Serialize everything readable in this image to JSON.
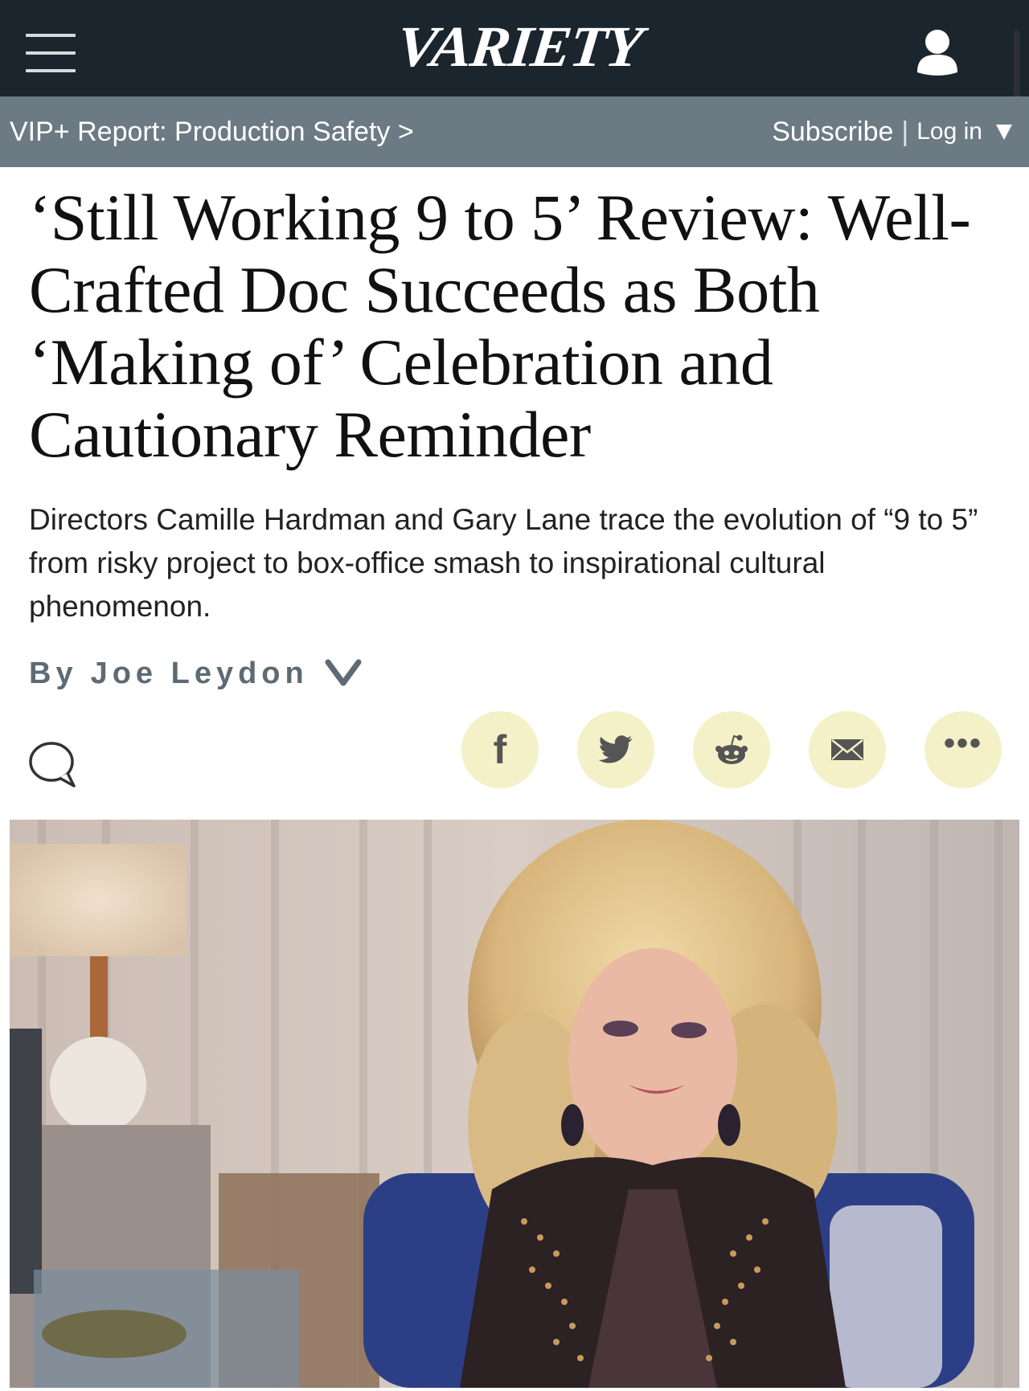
{
  "nav": {
    "logo": "VARIETY",
    "menu_icon": "hamburger-menu-icon",
    "user_icon": "user-icon"
  },
  "subbar": {
    "vip_link": "VIP+ Report: Production Safety >",
    "subscribe": "Subscribe",
    "separator": "|",
    "login": "Log in"
  },
  "article": {
    "headline": "‘Still Working 9 to 5’ Review: Well-Crafted Doc Succeeds as Both ‘Making of’ Celebration and Cautionary Reminder",
    "dek": "Directors Camille Hardman and Gary Lane trace the evolution of “9 to 5” from risky project to box-office smash to inspirational cultural phenomenon.",
    "byline_prefix": "By",
    "author": "Joe Leydon"
  },
  "share": {
    "facebook": "f",
    "more": "•••",
    "icons": [
      "facebook-icon",
      "twitter-icon",
      "reddit-icon",
      "email-icon",
      "more-icon"
    ]
  },
  "colors": {
    "topbar": "#1b252d",
    "subbar": "#6c7a84",
    "share_bg": "#f4f1c8",
    "byline": "#5d6b75"
  }
}
